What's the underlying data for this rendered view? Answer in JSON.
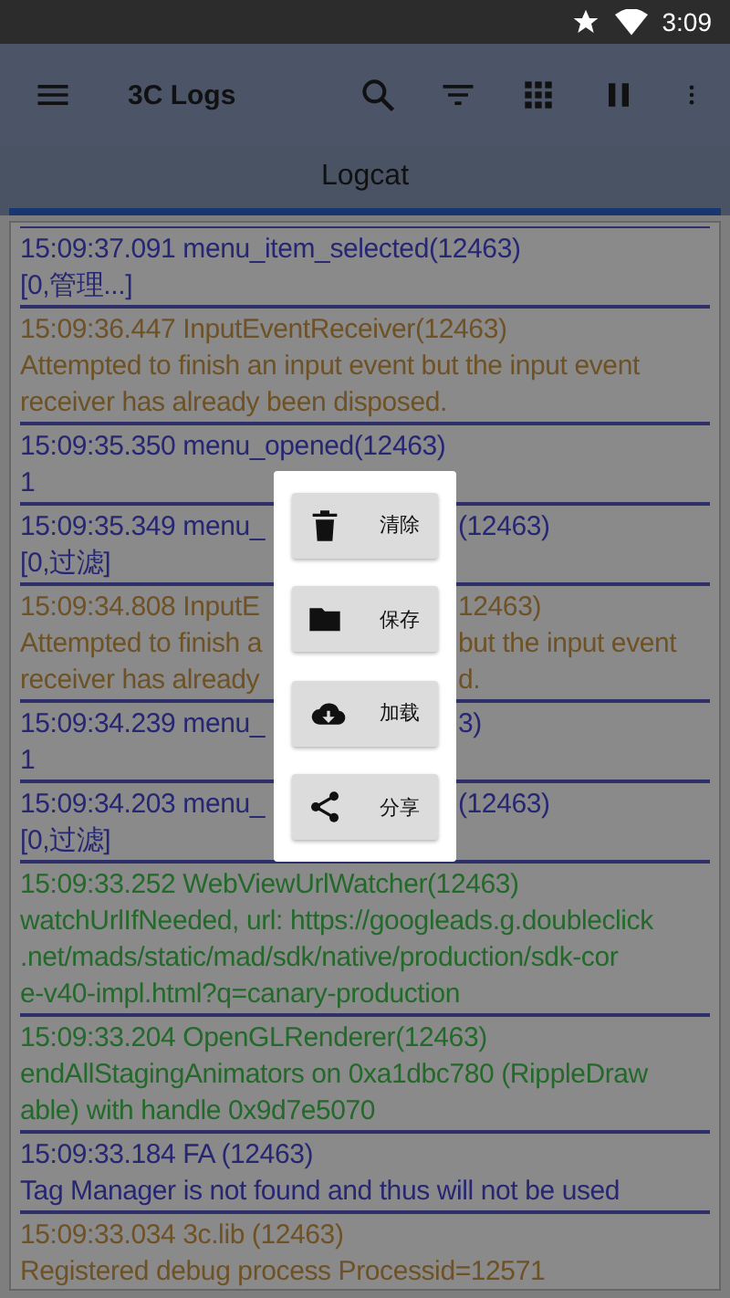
{
  "status_bar": {
    "time": "3:09"
  },
  "app_bar": {
    "title": "3C Logs"
  },
  "tabs": [
    {
      "label": "Logcat",
      "selected": true
    }
  ],
  "log_entries": [
    {
      "kind": "info",
      "lines": [
        "15:09:37.091 menu_item_selected(12463)",
        "[0,管理...]"
      ]
    },
    {
      "kind": "warn",
      "lines": [
        "15:09:36.447 InputEventReceiver(12463)",
        "Attempted to finish an input event but the input event",
        "receiver has already been disposed."
      ]
    },
    {
      "kind": "info",
      "lines": [
        "15:09:35.350 menu_opened(12463)",
        "1"
      ]
    },
    {
      "kind": "info",
      "lines": [
        [
          "15:09:35.349 menu_",
          "(12463)"
        ],
        "[0,过滤]"
      ]
    },
    {
      "kind": "warn",
      "lines": [
        [
          "15:09:34.808 InputE",
          "12463)"
        ],
        [
          "Attempted to finish a",
          "but the input event"
        ],
        [
          "receiver has already",
          "d."
        ]
      ]
    },
    {
      "kind": "info",
      "lines": [
        [
          "15:09:34.239 menu_",
          "3)"
        ],
        "1"
      ]
    },
    {
      "kind": "info",
      "lines": [
        [
          "15:09:34.203 menu_",
          "(12463)"
        ],
        "[0,过滤]"
      ]
    },
    {
      "kind": "debug",
      "lines": [
        "15:09:33.252 WebViewUrlWatcher(12463)",
        "watchUrlIfNeeded, url: https://googleads.g.doubleclick",
        ".net/mads/static/mad/sdk/native/production/sdk-cor",
        "e-v40-impl.html?q=canary-production"
      ]
    },
    {
      "kind": "debug",
      "lines": [
        "15:09:33.204 OpenGLRenderer(12463)",
        "endAllStagingAnimators on 0xa1dbc780 (RippleDraw",
        "able) with handle 0x9d7e5070"
      ]
    },
    {
      "kind": "info",
      "lines": [
        "15:09:33.184 FA      (12463)",
        "Tag Manager is not found and thus will not be used"
      ]
    },
    {
      "kind": "warn",
      "lines": [
        "15:09:33.034 3c.lib  (12463)",
        "Registered debug process Processid=12571"
      ]
    }
  ],
  "popup_menu": [
    {
      "kind": "clear",
      "label": "清除"
    },
    {
      "kind": "save",
      "label": "保存"
    },
    {
      "kind": "load",
      "label": "加载"
    },
    {
      "kind": "share",
      "label": "分享"
    }
  ]
}
